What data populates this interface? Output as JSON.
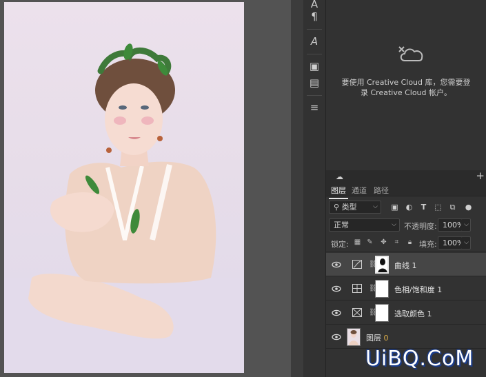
{
  "library": {
    "message_line1": "要使用 Creative Cloud 库，您需要登",
    "message_line2": "录 Creative Cloud 帐户。"
  },
  "layers_panel": {
    "tabs": [
      {
        "label": "图层",
        "active": true
      },
      {
        "label": "通道",
        "active": false
      },
      {
        "label": "路径",
        "active": false
      }
    ],
    "filter_kind": "类型",
    "blend_mode": "正常",
    "opacity_label": "不透明度:",
    "opacity_value": "100%",
    "lock_label": "锁定:",
    "fill_label": "填充:",
    "fill_value": "100%",
    "layers": [
      {
        "name": "曲线",
        "index": "1",
        "icon": "curves-icon",
        "selected": true
      },
      {
        "name": "色相/饱和度",
        "index": "1",
        "icon": "hue-saturation-icon",
        "selected": false
      },
      {
        "name": "选取颜色",
        "index": "1",
        "icon": "selective-color-icon",
        "selected": false
      },
      {
        "name": "图层",
        "index": "0",
        "icon": "photo-thumbnail",
        "selected": false
      }
    ]
  },
  "watermark": "UiBQ.CoM",
  "colors": {
    "panel_bg": "#323232",
    "canvas_bg": "#535353",
    "selected_layer": "#464646",
    "watermark_outline": "#1b3d8c"
  }
}
